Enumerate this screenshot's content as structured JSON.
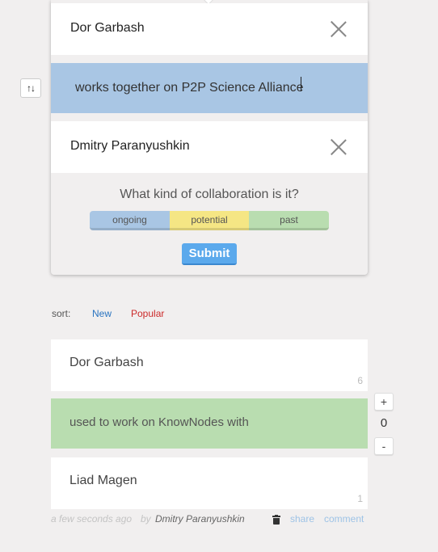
{
  "form": {
    "person_a": "Dor Garbash",
    "relation_value": "works together on P2P Science Alliance",
    "person_b": "Dmitry Paranyushkin",
    "question": "What kind of collaboration is it?",
    "options": [
      {
        "label": "ongoing",
        "color": "#a9c6e4"
      },
      {
        "label": "potential",
        "color": "#f5e684"
      },
      {
        "label": "past",
        "color": "#b9ddb0"
      }
    ],
    "submit_label": "Submit"
  },
  "swap_label": "↑↓",
  "sort": {
    "label": "sort:",
    "options": [
      "New",
      "Popular"
    ]
  },
  "connection": {
    "person_a": "Dor Garbash",
    "person_a_count": "6",
    "relation": "used to work on KnowNodes with",
    "relation_color": "#b9ddb0",
    "person_b": "Liad Magen",
    "person_b_count": "1",
    "votes": "0",
    "vote_up": "+",
    "vote_down": "-",
    "meta": {
      "time": "a few seconds ago",
      "by": "by",
      "author": "Dmitry Paranyushkin",
      "share": "share",
      "comment": "comment"
    }
  }
}
